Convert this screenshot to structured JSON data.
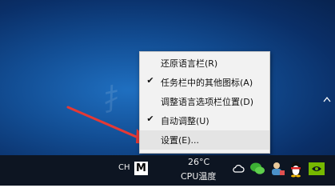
{
  "menu": {
    "items": [
      {
        "label": "还原语言栏(R)",
        "checked": false
      },
      {
        "label": "任务栏中的其他图标(A)",
        "checked": true
      },
      {
        "label": "调整语言选项栏位置(D)",
        "checked": false
      },
      {
        "label": "自动调整(U)",
        "checked": true
      },
      {
        "label": "设置(E)...",
        "checked": false
      }
    ],
    "check_mark": "✔"
  },
  "taskbar": {
    "lang": "CH",
    "ime_label": "M",
    "temperature": "26°C",
    "cpu_label": "CPU温度"
  },
  "desktop": {
    "watermark": "扌"
  },
  "colors": {
    "arrow": "#e53935",
    "taskbar": "#0d1522",
    "menu_bg": "#f2f2f2"
  },
  "icons": [
    "chevron-up-icon",
    "onedrive-cloud-icon",
    "wechat-icon",
    "user-tool-icon",
    "qq-penguin-icon",
    "nvidia-icon"
  ]
}
